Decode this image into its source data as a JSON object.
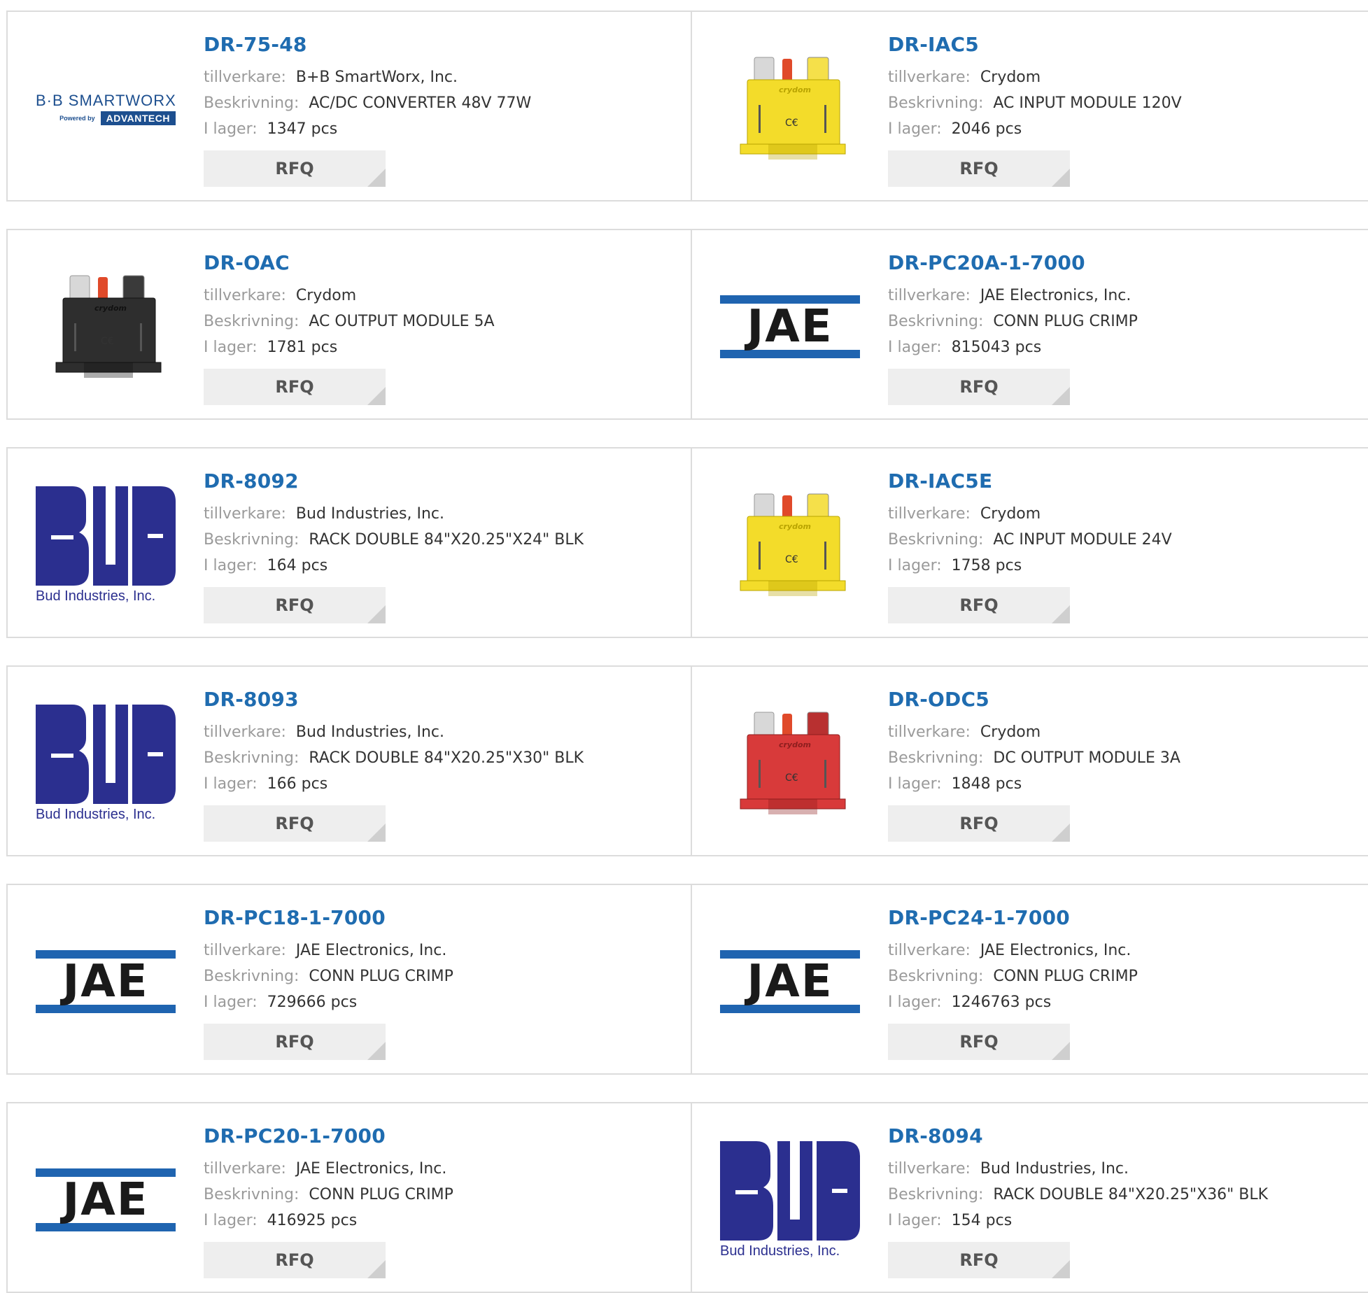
{
  "labels": {
    "manufacturer": "tillverkare:",
    "description": "Beskrivning:",
    "stock": "I lager:",
    "rfq": "RFQ"
  },
  "brand": {
    "jae": "JAE",
    "bud": "Bud Industries, Inc.",
    "bb_top": "B·B SMARTWORX",
    "bb_powered": "Powered by",
    "bb_adv": "ADVANTECH",
    "crydom": "crydom"
  },
  "colors": {
    "part_link": "#1f6cb0",
    "label_gray": "#9a9a9a",
    "jae_blue": "#1f64b0",
    "bud_blue": "#2b2f8f",
    "crydom_yellow": "#f3dc2a",
    "crydom_black": "#2e2e2e",
    "crydom_red": "#d83a3a"
  },
  "products": [
    {
      "part": "DR-75-48",
      "manufacturer": "B+B SmartWorx, Inc.",
      "description": "AC/DC CONVERTER 48V 77W",
      "stock": "1347 pcs",
      "logo": "bb"
    },
    {
      "part": "DR-IAC5",
      "manufacturer": "Crydom",
      "description": "AC INPUT MODULE 120V",
      "stock": "2046 pcs",
      "logo": "crydom-yellow"
    },
    {
      "part": "DR-OAC",
      "manufacturer": "Crydom",
      "description": "AC OUTPUT MODULE 5A",
      "stock": "1781 pcs",
      "logo": "crydom-black"
    },
    {
      "part": "DR-PC20A-1-7000",
      "manufacturer": "JAE Electronics, Inc.",
      "description": "CONN PLUG CRIMP",
      "stock": "815043 pcs",
      "logo": "jae"
    },
    {
      "part": "DR-8092",
      "manufacturer": "Bud Industries, Inc.",
      "description": "RACK DOUBLE 84\"X20.25\"X24\" BLK",
      "stock": "164 pcs",
      "logo": "bud"
    },
    {
      "part": "DR-IAC5E",
      "manufacturer": "Crydom",
      "description": "AC INPUT MODULE 24V",
      "stock": "1758 pcs",
      "logo": "crydom-yellow"
    },
    {
      "part": "DR-8093",
      "manufacturer": "Bud Industries, Inc.",
      "description": "RACK DOUBLE 84\"X20.25\"X30\" BLK",
      "stock": "166 pcs",
      "logo": "bud"
    },
    {
      "part": "DR-ODC5",
      "manufacturer": "Crydom",
      "description": "DC OUTPUT MODULE 3A",
      "stock": "1848 pcs",
      "logo": "crydom-red"
    },
    {
      "part": "DR-PC18-1-7000",
      "manufacturer": "JAE Electronics, Inc.",
      "description": "CONN PLUG CRIMP",
      "stock": "729666 pcs",
      "logo": "jae"
    },
    {
      "part": "DR-PC24-1-7000",
      "manufacturer": "JAE Electronics, Inc.",
      "description": "CONN PLUG CRIMP",
      "stock": "1246763 pcs",
      "logo": "jae"
    },
    {
      "part": "DR-PC20-1-7000",
      "manufacturer": "JAE Electronics, Inc.",
      "description": "CONN PLUG CRIMP",
      "stock": "416925 pcs",
      "logo": "jae"
    },
    {
      "part": "DR-8094",
      "manufacturer": "Bud Industries, Inc.",
      "description": "RACK DOUBLE 84\"X20.25\"X36\" BLK",
      "stock": "154 pcs",
      "logo": "bud"
    }
  ]
}
